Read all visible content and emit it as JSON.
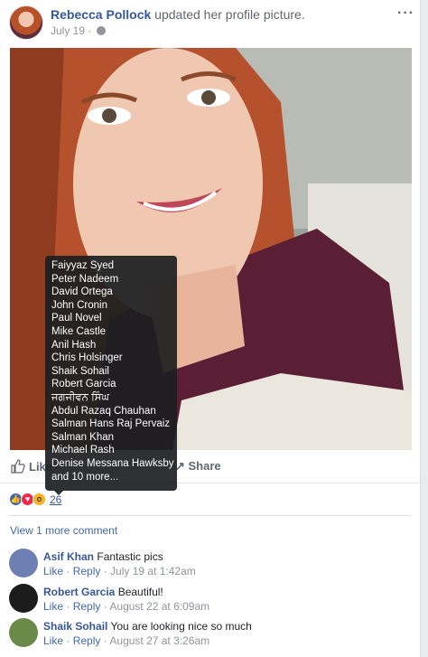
{
  "post": {
    "author": "Rebecca Pollock",
    "action": "updated her profile picture.",
    "date": "July 19 ·",
    "more_icon": "ellipsis-icon"
  },
  "actions": {
    "like": "Like",
    "share": "Share"
  },
  "reactions": {
    "count": "26",
    "types": [
      "like",
      "love",
      "wow"
    ]
  },
  "tooltip": {
    "names": [
      "Faiyyaz Syed",
      "Peter Nadeem",
      "David Ortega",
      "John Cronin",
      "Paul Novel",
      "Mike Castle",
      "Anil Hash",
      "Chris Holsinger",
      "Shaik Sohail",
      "Robert Garcia",
      "ਜਗਜੀਵਨ ਸਿੰਘ",
      "Abdul Razaq Chauhan",
      "Salman Hans Raj Pervaiz",
      "Salman Khan",
      "Michael Rash",
      "Denise Messana Hawksby",
      "and 10 more..."
    ]
  },
  "view_more": "View 1 more comment",
  "comments": [
    {
      "name": "Asif Khan",
      "text": "Fantastic pics",
      "like": "Like",
      "reply": "Reply",
      "time": "· July 19 at 1:42am",
      "avatar_color": "#6d7fb3"
    },
    {
      "name": "Robert Garcia",
      "text": "Beautiful!",
      "like": "Like",
      "reply": "Reply",
      "time": "· August 22 at 6:09am",
      "avatar_color": "#1c1c1c"
    },
    {
      "name": "Shaik Sohail",
      "text": "You are looking nice so much",
      "like": "Like",
      "reply": "Reply",
      "time": "· August 27 at 3:26am",
      "avatar_color": "#6a8a4a"
    }
  ],
  "colors": {
    "link": "#365899",
    "accent": "#4267b2",
    "muted": "#90949c"
  }
}
